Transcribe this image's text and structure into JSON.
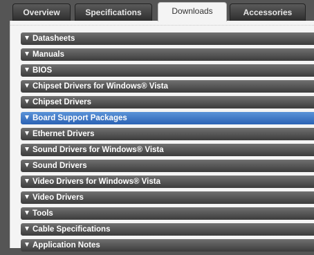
{
  "tabs": [
    {
      "label": "Overview",
      "active": false
    },
    {
      "label": "Specifications",
      "active": false
    },
    {
      "label": "Downloads",
      "active": true
    },
    {
      "label": "Accessories",
      "active": false
    }
  ],
  "downloads": {
    "items": [
      {
        "label": "Datasheets",
        "selected": false
      },
      {
        "label": "Manuals",
        "selected": false
      },
      {
        "label": "BIOS",
        "selected": false
      },
      {
        "label": "Chipset Drivers for Windows® Vista",
        "selected": false
      },
      {
        "label": "Chipset Drivers",
        "selected": false
      },
      {
        "label": "Board Support Packages",
        "selected": true
      },
      {
        "label": "Ethernet Drivers",
        "selected": false
      },
      {
        "label": "Sound Drivers for Windows® Vista",
        "selected": false
      },
      {
        "label": "Sound Drivers",
        "selected": false
      },
      {
        "label": "Video Drivers for Windows® Vista",
        "selected": false
      },
      {
        "label": "Video Drivers",
        "selected": false
      },
      {
        "label": "Tools",
        "selected": false
      },
      {
        "label": "Cable Specifications",
        "selected": false
      },
      {
        "label": "Application Notes",
        "selected": false
      }
    ]
  },
  "colors": {
    "row_default": "#4a4a4a",
    "row_selected": "#3a72c4",
    "tab_active_bg": "#f4f4f4"
  },
  "icons": {
    "row_toggle": "triangle-down-icon"
  }
}
